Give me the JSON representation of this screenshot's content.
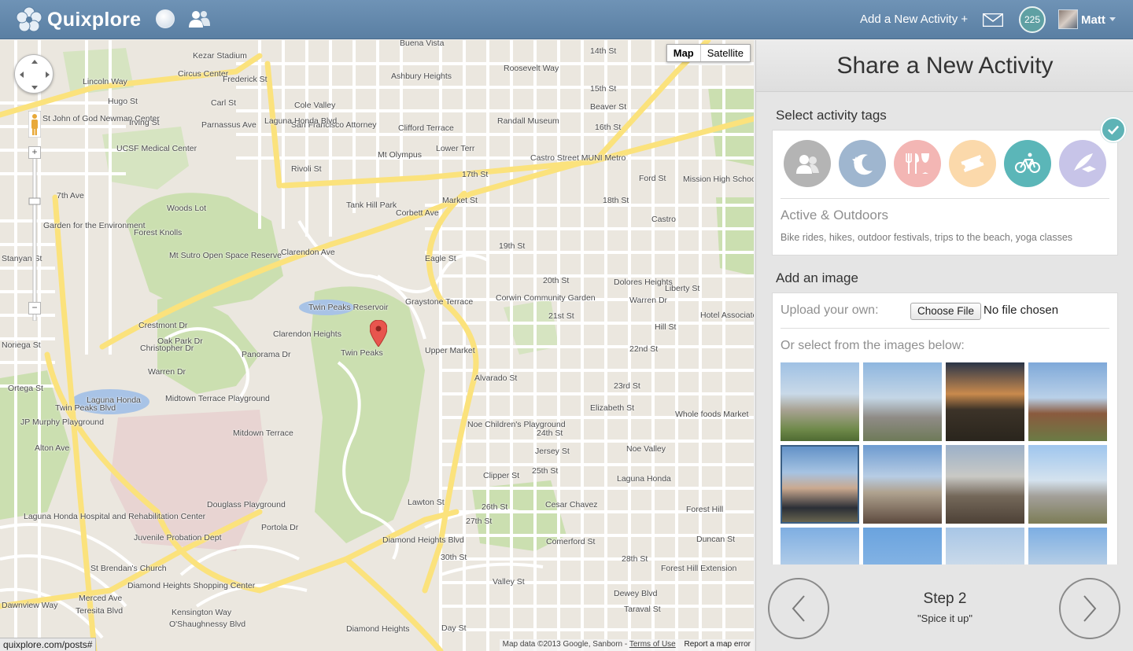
{
  "header": {
    "logo_text": "Quixplore",
    "add_activity_label": "Add a New Activity +",
    "notification_count": "225",
    "user_name": "Matt",
    "icons": [
      "flower-logo-icon",
      "globe-icon",
      "people-icon",
      "mail-icon",
      "caret-down-icon"
    ]
  },
  "map": {
    "type_buttons": [
      "Map",
      "Satellite"
    ],
    "selected_type": "Map",
    "marker_label": "Twin Peaks",
    "status_url": "quixplore.com/posts#",
    "attribution": "Map data ©2013 Google, Sanborn -",
    "terms_label": "Terms of Use",
    "report_label": "Report a map error",
    "labels": [
      "Kezar Stadium",
      "Circus Center",
      "Frederick St",
      "Buena Vista",
      "Lincoln Way",
      "14th St",
      "Beaver St",
      "Hugo St",
      "Carl St",
      "Cole Valley",
      "Ashbury Heights",
      "Roosevelt Way",
      "15th St",
      "Randall Museum",
      "St John of God Newman Center",
      "Irving St",
      "Parnassus Ave",
      "San Francisco Attorney",
      "Clifford Terrace",
      "Lower Terr",
      "16th St",
      "Castro Street MUNI Metro",
      "UCSF Medical Center",
      "Mt Olympus",
      "Rivoli St",
      "17th St",
      "Ford St",
      "Mission High School",
      "7th Ave",
      "Woods Lot",
      "Tank Hill Park",
      "Market St",
      "18th St",
      "Castro",
      "Garden for the Environment",
      "Forest Knolls",
      "Mt Sutro Open Space Reserve",
      "Clarendon Ave",
      "Eagle St",
      "19th St",
      "Corbett Ave",
      "20th St",
      "Dolores Heights",
      "Warren Dr",
      "Graystone Terrace",
      "Corwin Community Garden",
      "Liberty St",
      "Twin Peaks Reservoir",
      "21st St",
      "Hotel Associates",
      "Crestmont Dr",
      "Christopher Dr",
      "Oak Park Dr",
      "Clarendon Heights",
      "Twin Peaks",
      "Upper Market",
      "22nd St",
      "Hill St",
      "Noriega St",
      "Warren Dr",
      "Panorama Dr",
      "Alvarado St",
      "23rd St",
      "Ortega St",
      "Laguna Honda",
      "Midtown Terrace Playground",
      "Elizabeth St",
      "Whole foods Market",
      "JP Murphy Playground",
      "Mitdown Terrace",
      "Noe Children's Playground",
      "24th St",
      "Jersey St",
      "Noe Valley",
      "Alton Ave",
      "25th St",
      "Clipper St",
      "Laguna Honda",
      "26th St",
      "Douglass Playground",
      "Cesar Chavez",
      "Forest Hill",
      "Laguna Honda Hospital and Rehabilitation Center",
      "Juvenile Probation Dept",
      "Portola Dr",
      "Diamond Heights Blvd",
      "27th St",
      "Comerford St",
      "Duncan St",
      "28th St",
      "Forest Hill Extension",
      "Diamond Heights Shopping Center",
      "Valley St",
      "Dewey Blvd",
      "Merced Ave",
      "St Brendan's Church",
      "Kensington Way",
      "Teresita Blvd",
      "O'Shaughnessy Blvd",
      "Diamond Heights",
      "Day St",
      "30th St",
      "Taraval St",
      "Dawnview Way",
      "Lawton St",
      "Stanyan St",
      "Laguna Honda Blvd",
      "Twin Peaks Blvd"
    ]
  },
  "panel": {
    "title": "Share a New Activity",
    "tags_heading": "Select activity tags",
    "selected_tag_name": "Active & Outdoors",
    "selected_tag_desc": "Bike rides, hikes, outdoor festivals, trips to the beach, yoga classes",
    "tags": [
      {
        "icon": "people-tag-icon",
        "color": "#b4b4b4"
      },
      {
        "icon": "moon-stars-tag-icon",
        "color": "#9fb6cf"
      },
      {
        "icon": "fork-knife-glass-tag-icon",
        "color": "#f3b6b4"
      },
      {
        "icon": "ticket-tag-icon",
        "color": "#fbd9ab"
      },
      {
        "icon": "bicycle-tag-icon",
        "color": "#5bb6b8"
      },
      {
        "icon": "quill-cap-tag-icon",
        "color": "#c7c4e8"
      }
    ],
    "selected_tag_index": 4,
    "image_heading": "Add an image",
    "upload_label": "Upload your own:",
    "choose_file_label": "Choose File",
    "file_status": "No file chosen",
    "select_images_label": "Or select from the images below:",
    "selected_image_index": 4,
    "images": [
      "city-hillside-view",
      "city-skyline-haze",
      "sunset-over-hill",
      "red-dirt-overlook",
      "two-people-selfie",
      "people-on-rocks",
      "dusky-city-hill",
      "sunny-city-view",
      "city-blue-sky",
      "sutro-tower",
      "hazy-horizon",
      "downtown-skyline"
    ],
    "step_title": "Step 2",
    "step_subtitle": "\"Spice it up\""
  }
}
